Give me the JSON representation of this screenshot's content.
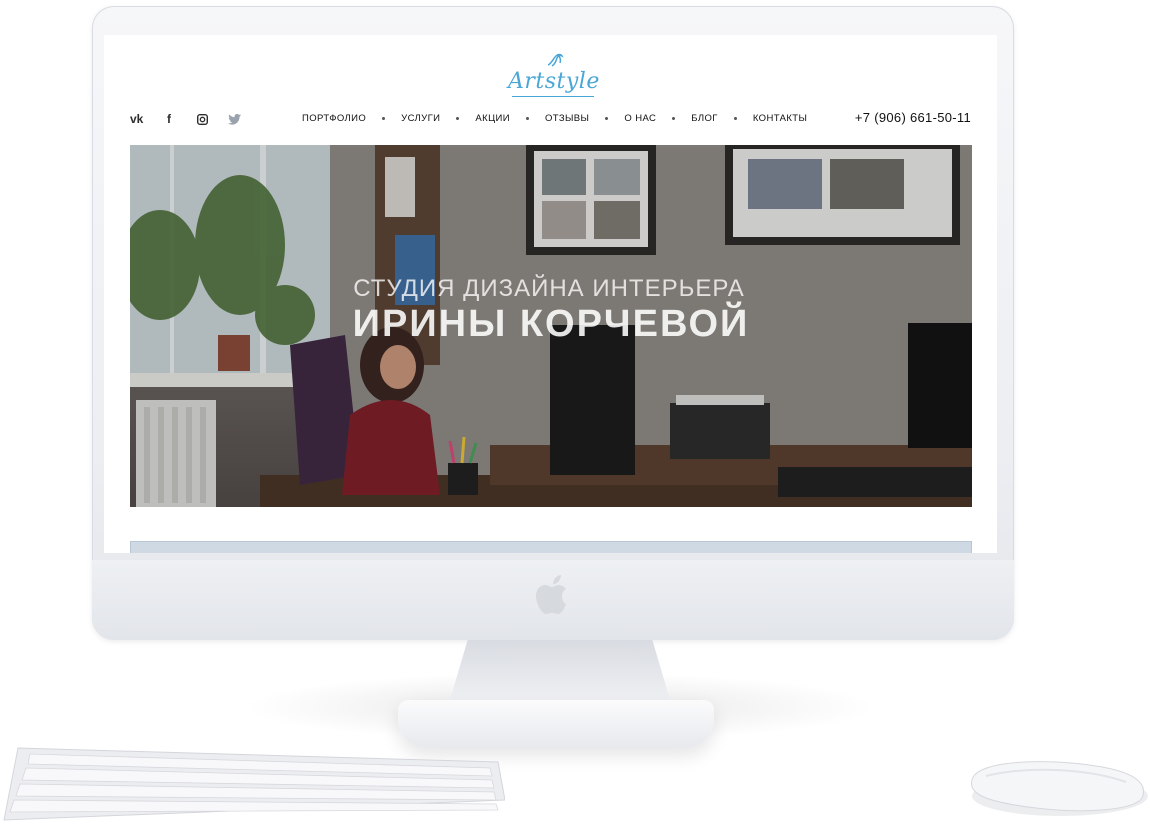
{
  "site": {
    "logo_text": "Artstyle",
    "phone": "+7 (906) 661-50-11",
    "social": [
      {
        "icon": "vk-icon",
        "glyph": "vk"
      },
      {
        "icon": "facebook-icon",
        "glyph": "f"
      },
      {
        "icon": "instagram-icon",
        "glyph": ""
      },
      {
        "icon": "twitter-icon",
        "glyph": ""
      }
    ],
    "nav": [
      "ПОРТФОЛИО",
      "УСЛУГИ",
      "АКЦИИ",
      "ОТЗЫВЫ",
      "О НАС",
      "БЛОГ",
      "КОНТАКТЫ"
    ]
  },
  "hero": {
    "subtitle": "СТУДИЯ ДИЗАЙНА ИНТЕРЬЕРА",
    "title": "ИРИНЫ КОРЧЕВОЙ"
  },
  "colors": {
    "accent": "#4aa6d6",
    "text": "#111111"
  }
}
